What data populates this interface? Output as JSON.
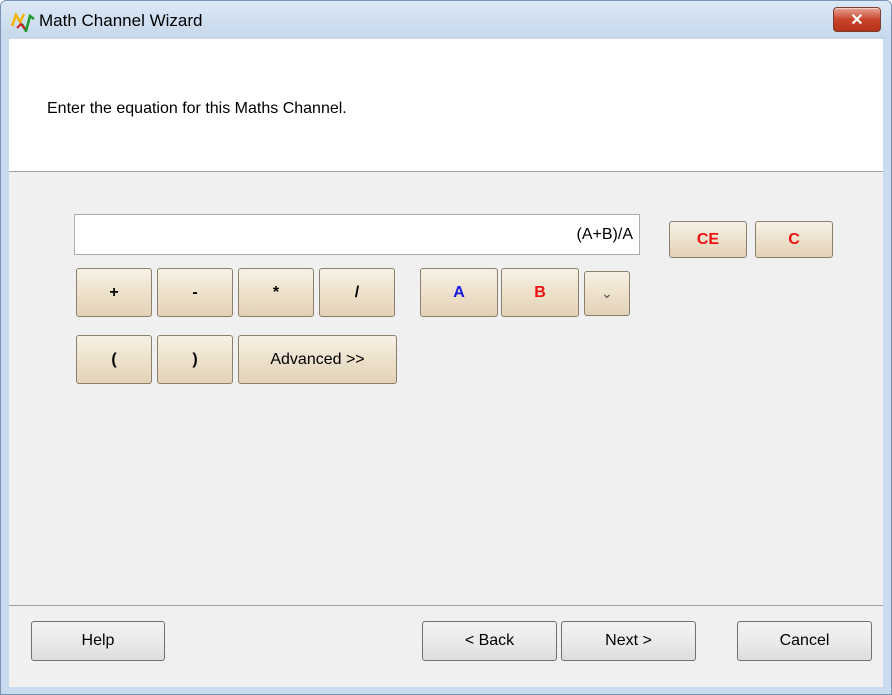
{
  "window": {
    "title": "Math Channel Wizard",
    "close_label": "✕"
  },
  "header": {
    "instruction": "Enter the equation for this Maths Channel."
  },
  "expression": {
    "value": "(A+B)/A"
  },
  "calculator": {
    "clear_entry": "CE",
    "clear": "C",
    "plus": "+",
    "minus": "-",
    "multiply": "*",
    "divide": "/",
    "channel_a": "A",
    "channel_b": "B",
    "more_channels": "⌄",
    "open_paren": "(",
    "close_paren": ")",
    "advanced": "Advanced >>"
  },
  "footer": {
    "help": "Help",
    "back": "< Back",
    "next": "Next >",
    "cancel": "Cancel"
  },
  "colors": {
    "channel_a": "#1818dd",
    "channel_b": "#ee1111",
    "clear_buttons": "#ee1111"
  }
}
